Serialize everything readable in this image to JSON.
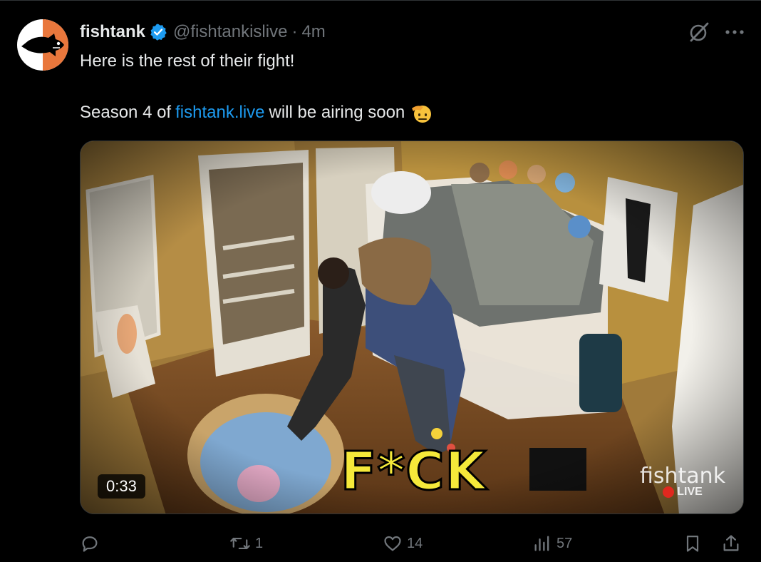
{
  "author": {
    "name": "fishtank",
    "handle": "@fishtankislive",
    "separator": "·",
    "time": "4m",
    "verified": true,
    "avatar_colors": {
      "left": "#ffffff",
      "right": "#e9773c",
      "fish": "#000000"
    }
  },
  "tweet": {
    "line1": "Here is the rest of their fight!",
    "line2_prefix": "Season 4 of",
    "link": "fishtank.live",
    "line2_suffix": "will be airing soon",
    "emoji": "saluting-face"
  },
  "media": {
    "duration": "0:33",
    "caption": "F*CK",
    "watermark_name": "fishtank",
    "watermark_live": "LIVE"
  },
  "actions": {
    "reply": {
      "icon": "reply-icon",
      "count": ""
    },
    "repost": {
      "icon": "repost-icon",
      "count": "1"
    },
    "like": {
      "icon": "heart-icon",
      "count": "14"
    },
    "views": {
      "icon": "views-icon",
      "count": "57"
    },
    "bookmark": {
      "icon": "bookmark-icon"
    },
    "share": {
      "icon": "share-icon"
    }
  },
  "colors": {
    "background": "#000000",
    "text": "#e7e9ea",
    "secondary": "#71767b",
    "link": "#1d9bf0",
    "caption": "#f5e93a"
  }
}
